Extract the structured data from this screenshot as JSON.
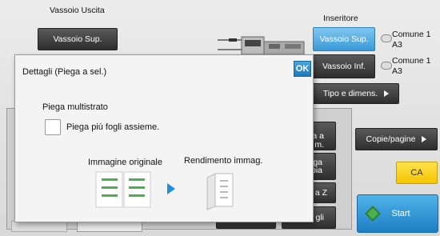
{
  "output_tray": {
    "label": "Vassoio Uscita",
    "button": "Vassoio Sup."
  },
  "inserter": {
    "label": "Inseritore",
    "upper_tray": "Vassoio Sup.",
    "lower_tray": "Vassoio Inf.",
    "upper_paper_type": "Comune 1",
    "upper_paper_size": "A3",
    "lower_paper_type": "Comune 1",
    "lower_paper_size": "A3",
    "type_size_button": "Tipo e dimens."
  },
  "dialog": {
    "title": "Dettagli (Piega a sel.)",
    "ok_label": "OK",
    "section_title": "Piega multistrato",
    "checkbox_label": "Piega più fogli assieme.",
    "original_label": "Immagine originale",
    "output_label": "Rendimento immag."
  },
  "behind_buttons": {
    "partial_1": "a a",
    "partial_1b": "m.",
    "partial_2": "ga",
    "partial_2b": "pia",
    "partial_3": "a Z",
    "partial_4": "gli"
  },
  "right_panel": {
    "copies_pages": "Copie/pagine",
    "ca": "CA",
    "start": "Start"
  },
  "colors": {
    "accent_blue": "#3b9ad6",
    "ca_yellow": "#f4c400",
    "start_blue": "#1e7fc3",
    "icon_green": "#4caf50"
  }
}
